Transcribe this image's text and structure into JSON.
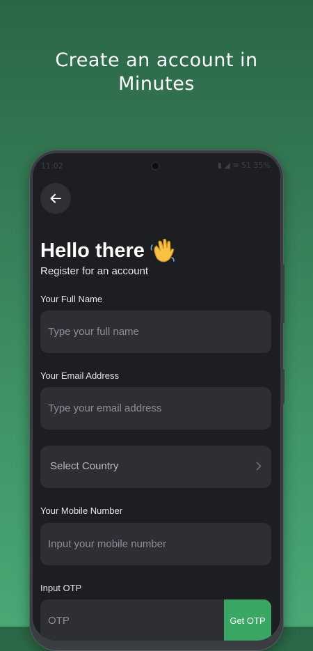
{
  "headline": {
    "line1": "Create an account in",
    "line2": "Minutes"
  },
  "status_bar": {
    "time": "11:02",
    "right_text": "51 35%"
  },
  "form": {
    "greeting": "Hello there",
    "greeting_emoji": "waving-hand-icon",
    "subtitle": "Register for an account",
    "full_name": {
      "label": "Your Full Name",
      "placeholder": "Type your full name",
      "value": ""
    },
    "email": {
      "label": "Your Email Address",
      "placeholder": "Type your email address",
      "value": ""
    },
    "country": {
      "value": "Select Country"
    },
    "mobile": {
      "label": "Your Mobile Number",
      "placeholder": "Input your mobile number",
      "value": ""
    },
    "otp": {
      "label": "Input OTP",
      "placeholder": "OTP",
      "button_label": "Get OTP"
    }
  },
  "colors": {
    "background_top": "#2b6646",
    "background_bottom": "#48a874",
    "screen": "#1c1e22",
    "field": "#2d2f35",
    "accent": "#3aa864",
    "wave_emoji": "#f5c242"
  }
}
